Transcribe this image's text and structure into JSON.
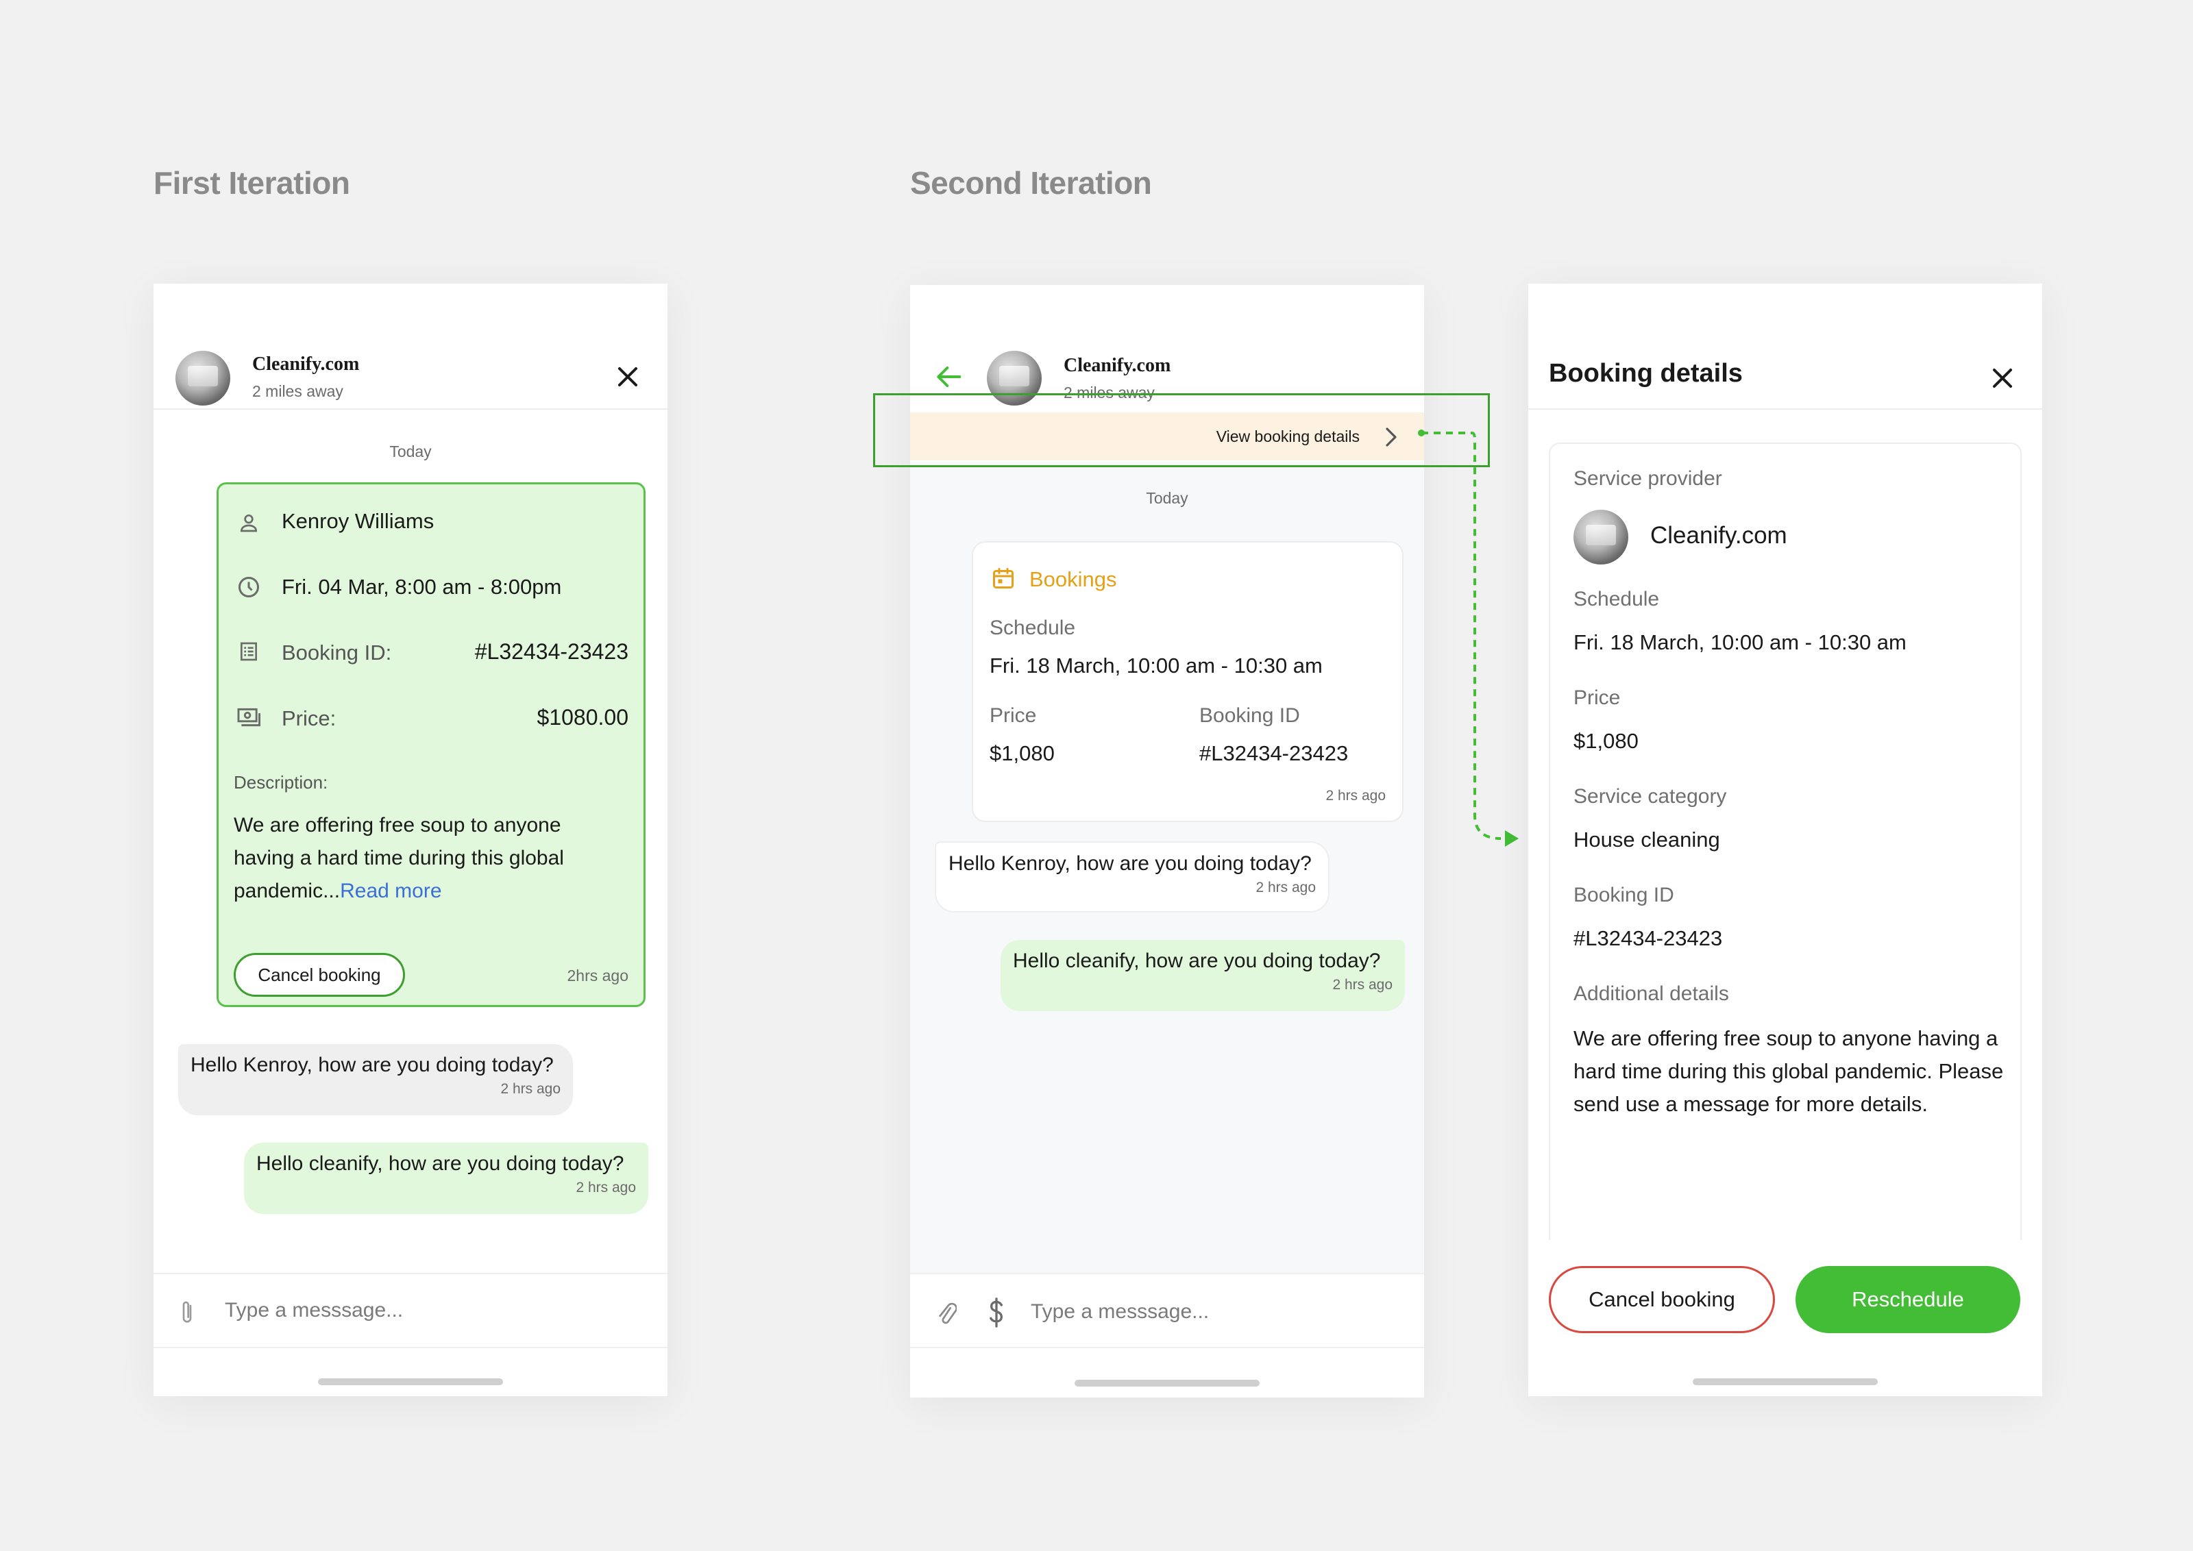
{
  "sections": {
    "first_title": "First Iteration",
    "second_title": "Second Iteration"
  },
  "colors": {
    "background": "#f1f1f1",
    "accent_green": "#43bd35",
    "card_green": "#e2f8dd",
    "bookings_orange": "#e4a117",
    "banner_peach": "#fdf1e1",
    "cancel_red": "#d9473e",
    "link_blue": "#3a6fd8"
  },
  "first": {
    "header": {
      "name": "Cleanify.com",
      "distance": "2 miles away",
      "close_icon": "close-icon"
    },
    "today": "Today",
    "card": {
      "person": "Kenroy Williams",
      "datetime": "Fri. 04 Mar, 8:00 am - 8:00pm",
      "booking_id_label": "Booking ID:",
      "booking_id": "#L32434-23423",
      "price_label": "Price:",
      "price": "$1080.00",
      "description_label": "Description:",
      "description": "We are offering free soup to anyone having a hard time during this global pandemic...",
      "read_more": "Read more",
      "cancel_button": "Cancel booking",
      "time": "2hrs ago"
    },
    "messages": [
      {
        "text": "Hello Kenroy, how are you doing today?",
        "time": "2 hrs ago"
      },
      {
        "text": "Hello cleanify, how are you doing today?",
        "time": "2 hrs ago"
      }
    ],
    "composer": {
      "placeholder": "Type a messsage..."
    }
  },
  "second": {
    "header": {
      "name": "Cleanify.com",
      "distance": "2 miles away"
    },
    "banner": {
      "text": "View booking details"
    },
    "today": "Today",
    "booking_card": {
      "title": "Bookings",
      "schedule_label": "Schedule",
      "schedule": "Fri. 18 March, 10:00 am - 10:30 am",
      "price_label": "Price",
      "price": "$1,080",
      "booking_id_label": "Booking ID",
      "booking_id": "#L32434-23423",
      "time": "2 hrs ago"
    },
    "messages": [
      {
        "text": "Hello Kenroy, how are you doing today?",
        "time": "2 hrs ago"
      },
      {
        "text": "Hello cleanify, how are you doing today?",
        "time": "2 hrs ago"
      }
    ],
    "composer": {
      "placeholder": "Type a messsage..."
    }
  },
  "details": {
    "title": "Booking details",
    "service_provider_label": "Service provider",
    "provider_name": "Cleanify.com",
    "schedule_label": "Schedule",
    "schedule": "Fri. 18 March, 10:00 am - 10:30 am",
    "price_label": "Price",
    "price": "$1,080",
    "category_label": "Service category",
    "category": "House cleaning",
    "booking_id_label": "Booking ID",
    "booking_id": "#L32434-23423",
    "additional_label": "Additional details",
    "additional": "We are offering free soup to anyone having a hard time during this global pandemic. Please send use a message for more details.",
    "cancel_button": "Cancel booking",
    "reschedule_button": "Reschedule"
  }
}
